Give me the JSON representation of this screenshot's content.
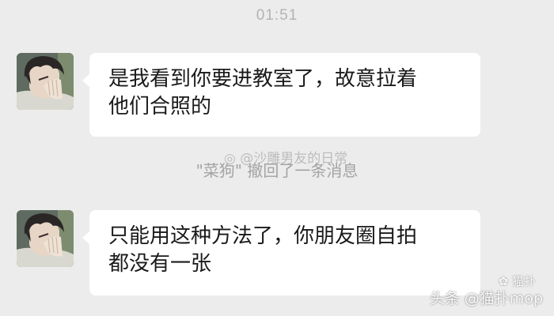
{
  "chat": {
    "timestamp": "01:51",
    "messages": [
      {
        "sender_avatar": "anime-boy-avatar",
        "lines": [
          "是我看到你要进教室了，故意拉着",
          "他们合照的"
        ]
      },
      {
        "sender_avatar": "anime-boy-avatar",
        "lines": [
          "只能用这种方法了，你朋友圈自拍",
          "都没有一张"
        ]
      }
    ],
    "recall_notice": "\"菜狗\" 撤回了一条消息"
  },
  "watermarks": {
    "middle": "@沙雕男友的日常",
    "corner": "头条 @猫扑mop",
    "corner_small": "猫扑"
  },
  "colors": {
    "background": "#ececec",
    "bubble": "#ffffff",
    "timestamp_text": "#b3b3b3",
    "notice_text": "#a3a3a3"
  }
}
